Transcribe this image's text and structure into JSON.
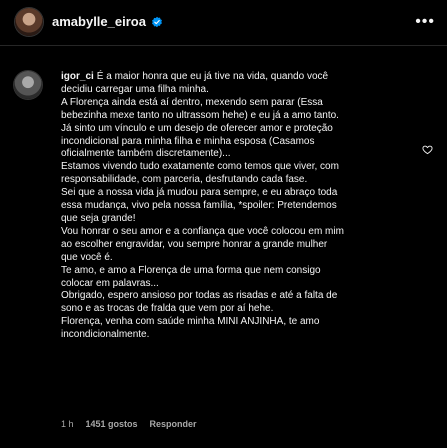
{
  "header": {
    "username": "amabylle_eiroa",
    "verified_icon": "verified-badge-icon",
    "more_icon": "more-options-icon"
  },
  "comment": {
    "username": "igor_ci",
    "lines": [
      "É a maior honra que eu já tive na vida, quando você",
      "decidiu carregar uma filha minha.",
      "A Florença ainda está aí dentro, mexendo sem parar (Essa",
      "bebezinha mexe tanto no ultrassom hehe) e eu já a amo tanto.",
      "Já sinto um vínculo e um desejo de oferecer amor e proteção",
      "incondicional para minha filha e minha esposa (Casamos",
      "oficialmente também discretamente)...",
      "Estamos vivendo tudo exatamente como temos que viver, com",
      "responsabilidade, com parceria, desfrutando cada fase.",
      "Sei que a nossa vida já mudou para sempre, e eu abraço toda",
      "essa mudança, vivo pela nossa família, *spoiler: Pretendemos",
      "que seja grande!",
      "Vou honrar o seu amor e a confiança que você colocou em mim",
      "ao escolher engravidar, vou sempre honrar a grande mulher",
      "que você é.",
      "Te amo, e amo a Florença de uma forma que nem consigo",
      "colocar em palavras...",
      "Obrigado, espero ansioso por todas as risadas e até a falta de",
      "sono e as trocas de fralda que vem por aí hehe.",
      "Florença, venha com saúde minha MINI ANJINHA, te amo",
      "incondicionalmente."
    ],
    "time": "1 h",
    "likes": "1451 gostos",
    "reply_label": "Responder",
    "like_icon": "heart-icon"
  },
  "colors": {
    "background": "#000000",
    "text": "#f5f5f5",
    "secondary_text": "#a8a8a8",
    "verified": "#0095f6"
  }
}
